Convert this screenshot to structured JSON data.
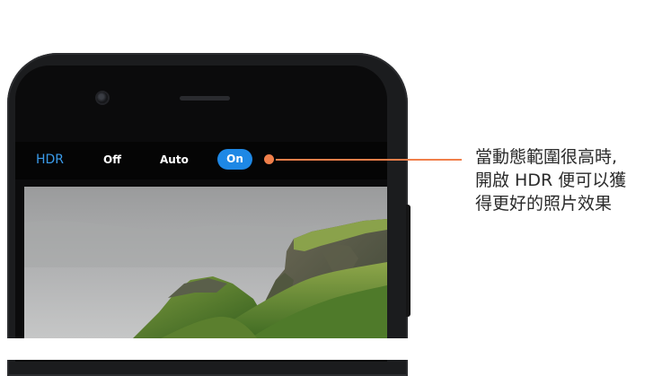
{
  "hdr_bar": {
    "label": "HDR",
    "options": {
      "off": "Off",
      "auto": "Auto",
      "on": "On"
    },
    "selected": "On",
    "accent_color": "#1e88e5",
    "label_color": "#3a9bea"
  },
  "callout": {
    "line1": "當動態範圍很高時,",
    "line2": "開啟 HDR 便可以獲",
    "line3": "得更好的照片效果",
    "connector_color": "#f07f4a"
  },
  "icons": {
    "front_camera": "front-camera-icon",
    "earpiece": "earpiece-speaker-icon"
  }
}
